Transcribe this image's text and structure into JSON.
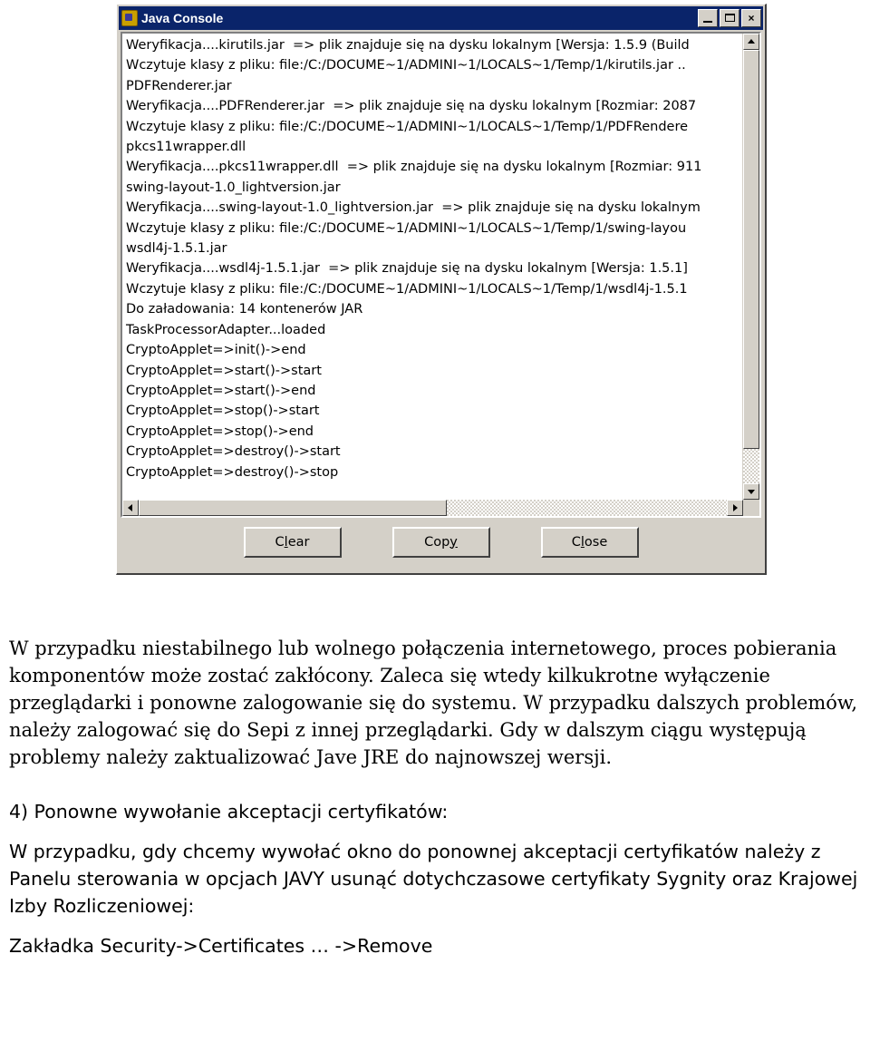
{
  "window": {
    "title": "Java Console",
    "icon": "java-cup-icon",
    "buttons": {
      "minimize": "minimize-button",
      "maximize": "maximize-button",
      "close": "×"
    },
    "log_lines": [
      "Weryfikacja....kirutils.jar  => plik znajduje się na dysku lokalnym [Wersja: 1.5.9 (Build",
      "Wczytuje klasy z pliku: file:/C:/DOCUME~1/ADMINI~1/LOCALS~1/Temp/1/kirutils.jar ..",
      "PDFRenderer.jar",
      "Weryfikacja....PDFRenderer.jar  => plik znajduje się na dysku lokalnym [Rozmiar: 2087",
      "Wczytuje klasy z pliku: file:/C:/DOCUME~1/ADMINI~1/LOCALS~1/Temp/1/PDFRendere",
      "pkcs11wrapper.dll",
      "Weryfikacja....pkcs11wrapper.dll  => plik znajduje się na dysku lokalnym [Rozmiar: 911",
      "swing-layout-1.0_lightversion.jar",
      "Weryfikacja....swing-layout-1.0_lightversion.jar  => plik znajduje się na dysku lokalnym",
      "Wczytuje klasy z pliku: file:/C:/DOCUME~1/ADMINI~1/LOCALS~1/Temp/1/swing-layou",
      "wsdl4j-1.5.1.jar",
      "Weryfikacja....wsdl4j-1.5.1.jar  => plik znajduje się na dysku lokalnym [Wersja: 1.5.1]",
      "Wczytuje klasy z pliku: file:/C:/DOCUME~1/ADMINI~1/LOCALS~1/Temp/1/wsdl4j-1.5.1",
      "Do załadowania: 14 kontenerów JAR",
      "TaskProcessorAdapter...loaded",
      "CryptoApplet=>init()->end",
      "CryptoApplet=>start()->start",
      "CryptoApplet=>start()->end",
      "CryptoApplet=>stop()->start",
      "CryptoApplet=>stop()->end",
      "CryptoApplet=>destroy()->start",
      "CryptoApplet=>destroy()->stop"
    ],
    "actions": {
      "clear": {
        "pre": "C",
        "mnemonic": "l",
        "post": "ear",
        "full": "Clear"
      },
      "copy": {
        "pre": "Cop",
        "mnemonic": "y",
        "post": "",
        "full": "Copy"
      },
      "close": {
        "pre": "C",
        "mnemonic": "l",
        "post": "ose",
        "full": "Close"
      }
    }
  },
  "document": {
    "paragraph1": "W przypadku niestabilnego lub wolnego połączenia internetowego, proces pobierania komponentów może zostać zakłócony. Zaleca się wtedy kilkukrotne wyłączenie przeglądarki i ponowne zalogowanie się do systemu. W przypadku dalszych problemów, należy zalogować się do Sepi z innej przeglądarki. Gdy w dalszym ciągu występują problemy należy zaktualizować Jave JRE do najnowszej wersji.",
    "heading": "4) Ponowne wywołanie akceptacji certyfikatów:",
    "paragraph2": "W przypadku, gdy chcemy wywołać okno do ponownej akceptacji certyfikatów należy z Panelu sterowania w opcjach JAVY usunąć dotychczasowe certyfikaty Sygnity oraz Krajowej Izby Rozliczeniowej:",
    "paragraph3": "Zakładka Security->Certificates … ->Remove"
  }
}
